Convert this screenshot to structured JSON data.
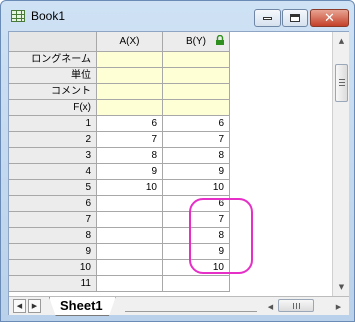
{
  "window": {
    "title": "Book1"
  },
  "columns": [
    {
      "header": "A(X)",
      "locked": false
    },
    {
      "header": "B(Y)",
      "locked": true
    }
  ],
  "meta_rows": [
    "ロングネーム",
    "単位",
    "コメント",
    "F(x)"
  ],
  "rows": [
    {
      "num": "1",
      "a": "6",
      "b": "6"
    },
    {
      "num": "2",
      "a": "7",
      "b": "7"
    },
    {
      "num": "3",
      "a": "8",
      "b": "8"
    },
    {
      "num": "4",
      "a": "9",
      "b": "9"
    },
    {
      "num": "5",
      "a": "10",
      "b": "10"
    },
    {
      "num": "6",
      "a": "",
      "b": "6"
    },
    {
      "num": "7",
      "a": "",
      "b": "7"
    },
    {
      "num": "8",
      "a": "",
      "b": "8"
    },
    {
      "num": "9",
      "a": "",
      "b": "9"
    },
    {
      "num": "10",
      "a": "",
      "b": "10"
    },
    {
      "num": "11",
      "a": "",
      "b": ""
    }
  ],
  "sheet_tab": "Sheet1",
  "colors": {
    "highlight": "#e62fc7",
    "meta_fill": "#ffffd6",
    "lock": "#2f8f1f"
  },
  "icons": [
    "workbook-icon",
    "lock-icon",
    "minimize-icon",
    "maximize-icon",
    "close-icon"
  ]
}
